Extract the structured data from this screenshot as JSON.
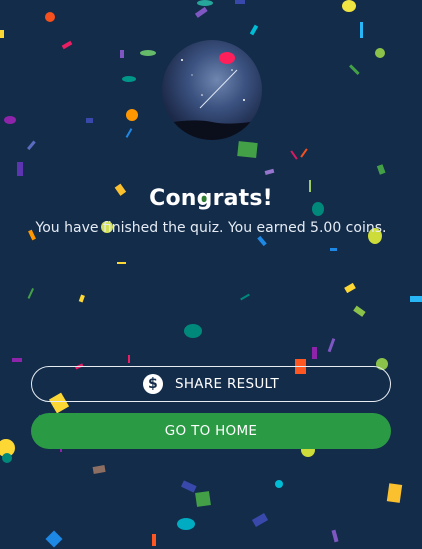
{
  "result": {
    "title": "Congrats!",
    "message": "You have finished the quiz. You earned 5.00 coins."
  },
  "actions": {
    "share_label": "SHARE RESULT",
    "home_label": "GO TO HOME"
  },
  "icons": {
    "share": "dollar-coin-icon",
    "avatar": "night-sky-image"
  },
  "colors": {
    "background": "#132c4a",
    "primary_button": "#2b9a45"
  }
}
